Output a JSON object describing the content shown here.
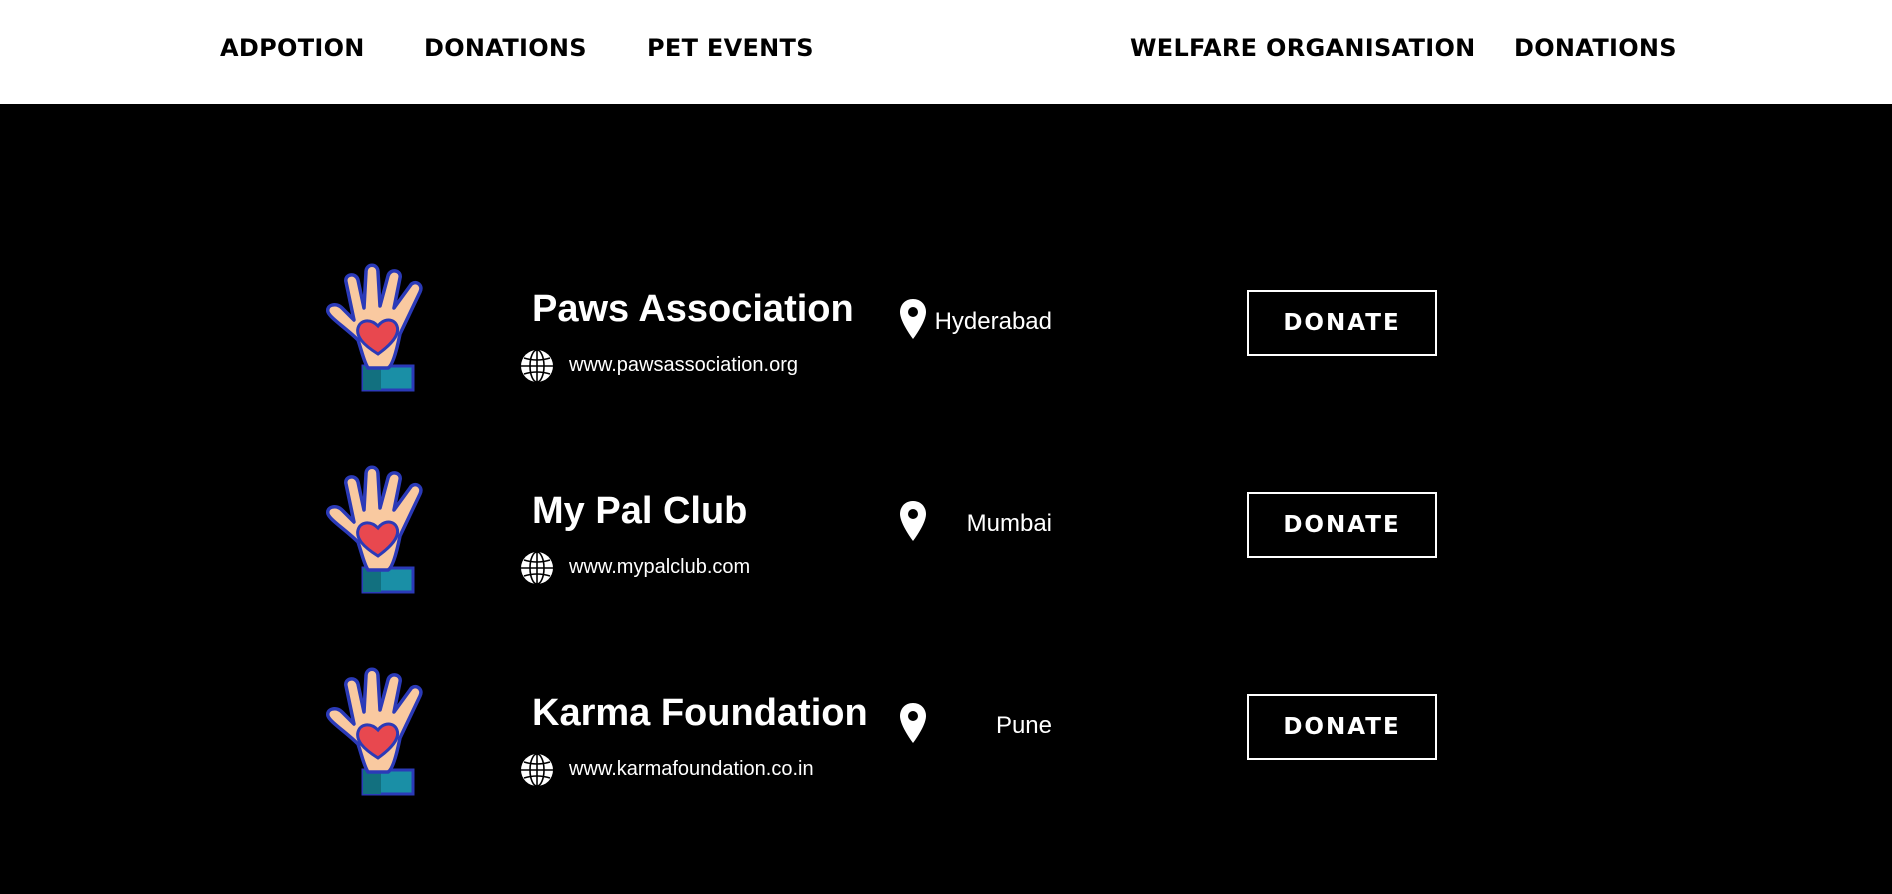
{
  "nav": {
    "left": [
      {
        "label": "ADPOTION"
      },
      {
        "label": "DONATIONS"
      },
      {
        "label": "PET EVENTS"
      }
    ],
    "right": [
      {
        "label": "WELFARE ORGANISATION"
      },
      {
        "label": "DONATIONS"
      }
    ]
  },
  "organizations": [
    {
      "name": "Paws Association",
      "url": "www.pawsassociation.org",
      "city": "Hyderabad",
      "button": "DONATE"
    },
    {
      "name": "My Pal Club",
      "url": "www.mypalclub.com",
      "city": "Mumbai",
      "button": "DONATE"
    },
    {
      "name": "Karma Foundation",
      "url": "www.karmafoundation.co.in",
      "city": "Pune",
      "button": "DONATE"
    }
  ],
  "icons": {
    "logo": "hand-heart-icon",
    "website": "globe-icon",
    "location": "location-pin-icon"
  },
  "colors": {
    "nav_background": "#ffffff",
    "page_background": "#000000",
    "hand_skin": "#f9c9a0",
    "hand_outline": "#2b3ab8",
    "heart": "#e8484f",
    "cuff": "#1a8fa6"
  }
}
